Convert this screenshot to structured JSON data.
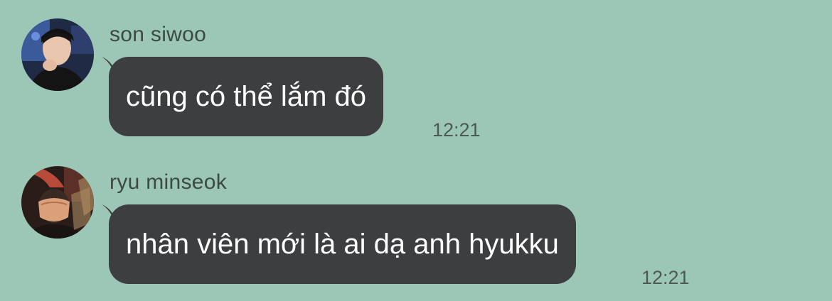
{
  "messages": [
    {
      "sender": "son siwoo",
      "text": "cũng có thể lắm đó",
      "time": "12:21",
      "avatar_icon": "user-avatar-photo"
    },
    {
      "sender": "ryu minseok",
      "text": "nhân viên mới là ai dạ anh hyukku",
      "time": "12:21",
      "avatar_icon": "user-avatar-photo"
    }
  ],
  "colors": {
    "background": "#9cc7b6",
    "bubble": "#3d3e40",
    "bubble_text": "#ffffff",
    "sender_text": "#3c4a44",
    "time_text": "#4c5a54"
  }
}
